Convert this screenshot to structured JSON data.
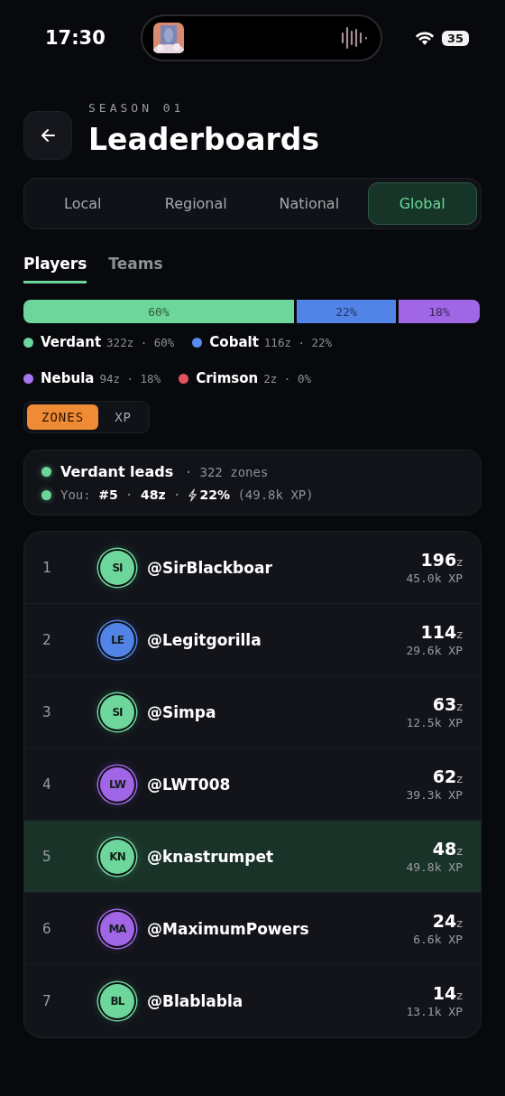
{
  "status_bar": {
    "time": "17:30",
    "battery": "35"
  },
  "header": {
    "season": "SEASON 01",
    "title": "Leaderboards"
  },
  "scope_tabs": [
    {
      "label": "Local",
      "selected": false
    },
    {
      "label": "Regional",
      "selected": false
    },
    {
      "label": "National",
      "selected": false
    },
    {
      "label": "Global",
      "selected": true
    }
  ],
  "view_tabs": [
    {
      "label": "Players",
      "selected": true
    },
    {
      "label": "Teams",
      "selected": false
    }
  ],
  "share_bar": [
    {
      "label": "60%",
      "color": "#6dd69a"
    },
    {
      "label": "22%",
      "color": "#5283e6"
    },
    {
      "label": "18%",
      "color": "#a066e6"
    }
  ],
  "legend": [
    {
      "name": "Verdant",
      "stats": "322z · 60%",
      "color": "#6dd69a"
    },
    {
      "name": "Cobalt",
      "stats": "116z · 22%",
      "color": "#5a8cf0"
    },
    {
      "name": "Nebula",
      "stats": "94z · 18%",
      "color": "#a678f0"
    },
    {
      "name": "Crimson",
      "stats": "2z · 0%",
      "color": "#e5525f"
    }
  ],
  "metric_toggle": [
    {
      "label": "ZONES",
      "selected": true
    },
    {
      "label": "XP",
      "selected": false
    }
  ],
  "summary": {
    "leader": "**Verdant leads** · 322 zones",
    "you": "You: **#5** · **48z** ·",
    "boost": "**22%** (49.8k XP)"
  },
  "rows": [
    {
      "rank": "1",
      "initials": "SI",
      "handle": "@SirBlackboar",
      "zones": "196",
      "unit": "z",
      "xp": "45.0k XP",
      "color": "#6dd69a",
      "selected": false
    },
    {
      "rank": "2",
      "initials": "LE",
      "handle": "@Legitgorilla",
      "zones": "114",
      "unit": "z",
      "xp": "29.6k XP",
      "color": "#5283e6",
      "selected": false
    },
    {
      "rank": "3",
      "initials": "SI",
      "handle": "@Simpa",
      "zones": "63",
      "unit": "z",
      "xp": "12.5k XP",
      "color": "#6dd69a",
      "selected": false
    },
    {
      "rank": "4",
      "initials": "LW",
      "handle": "@LWT008",
      "zones": "62",
      "unit": "z",
      "xp": "39.3k XP",
      "color": "#a066e6",
      "selected": false
    },
    {
      "rank": "5",
      "initials": "KN",
      "handle": "@knastrumpet",
      "zones": "48",
      "unit": "z",
      "xp": "49.8k XP",
      "color": "#6dd69a",
      "selected": true
    },
    {
      "rank": "6",
      "initials": "MA",
      "handle": "@MaximumPowers",
      "zones": "24",
      "unit": "z",
      "xp": "6.6k XP",
      "color": "#a066e6",
      "selected": false
    },
    {
      "rank": "7",
      "initials": "BL",
      "handle": "@Blablabla",
      "zones": "14",
      "unit": "z",
      "xp": "13.1k XP",
      "color": "#6dd69a",
      "selected": false
    }
  ]
}
